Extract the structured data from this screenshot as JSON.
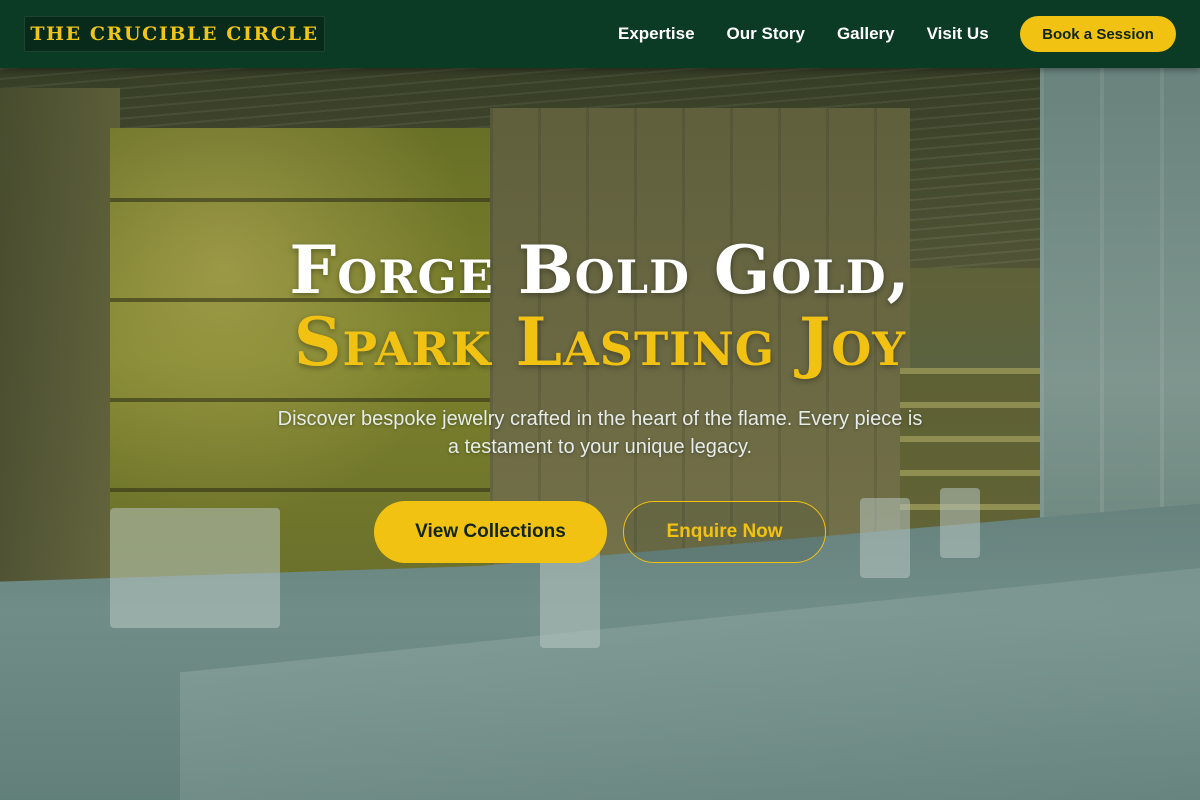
{
  "header": {
    "logo_text": "THE CRUCIBLE CIRCLE",
    "nav": [
      {
        "label": "Expertise"
      },
      {
        "label": "Our Story"
      },
      {
        "label": "Gallery"
      },
      {
        "label": "Visit Us"
      }
    ],
    "cta_label": "Book a Session"
  },
  "hero": {
    "headline_line1": "Forge Bold Gold,",
    "headline_line2": "Spark Lasting Joy",
    "subtitle": "Discover bespoke jewelry crafted in the heart of the flame. Every piece is a testament to your unique legacy.",
    "primary_button": "View Collections",
    "secondary_button": "Enquire Now",
    "background_image": "jewelry-store-interior"
  },
  "colors": {
    "header_bg": "#0b3a25",
    "accent_gold": "#f2c212",
    "text_white": "#ffffff"
  }
}
